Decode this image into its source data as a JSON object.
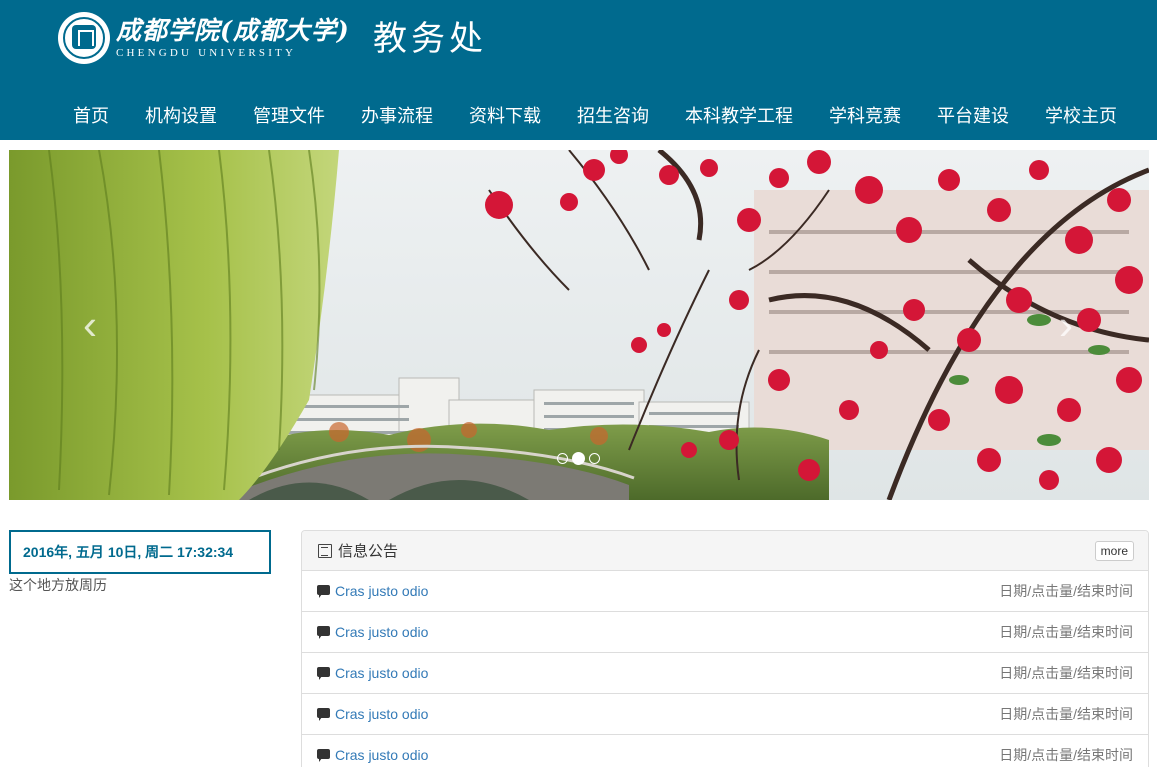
{
  "header": {
    "brand_cn": "成都学院(成都大学)",
    "brand_en": "CHENGDU UNIVERSITY",
    "department": "教务处",
    "bg_color": "#006a8e"
  },
  "nav": {
    "items": [
      "首页",
      "机构设置",
      "管理文件",
      "办事流程",
      "资料下载",
      "招生咨询",
      "本科教学工程",
      "学科竞赛",
      "平台建设",
      "学校主页"
    ]
  },
  "carousel": {
    "prev_icon": "chevron-left-icon",
    "next_icon": "chevron-right-icon",
    "prev_glyph": "‹",
    "next_glyph": "›",
    "slide_count": 3,
    "active_index": 1
  },
  "datetime": {
    "text": "2016年, 五月 10日, 周二   17:32:34"
  },
  "calendar_note": "这个地方放周历",
  "notices": {
    "title": "信息公告",
    "more_label": "more",
    "items": [
      {
        "title": "Cras justo odio",
        "meta": "日期/点击量/结束时间"
      },
      {
        "title": "Cras justo odio",
        "meta": "日期/点击量/结束时间"
      },
      {
        "title": "Cras justo odio",
        "meta": "日期/点击量/结束时间"
      },
      {
        "title": "Cras justo odio",
        "meta": "日期/点击量/结束时间"
      },
      {
        "title": "Cras justo odio",
        "meta": "日期/点击量/结束时间"
      }
    ]
  }
}
